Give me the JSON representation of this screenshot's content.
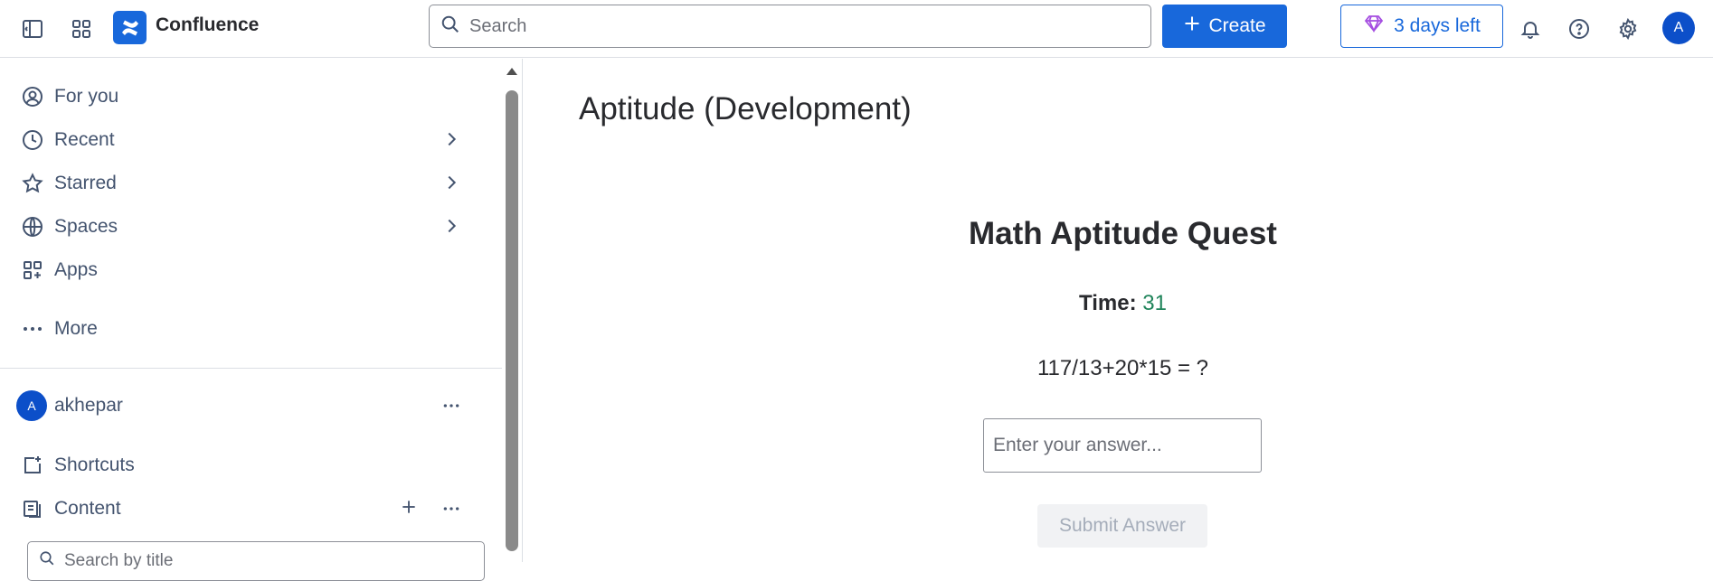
{
  "topbar": {
    "brand": "Confluence",
    "search_placeholder": "Search",
    "create_label": "Create",
    "trial_label": "3 days left",
    "avatar_initial": "A",
    "icons": [
      "sidebar-toggle-icon",
      "app-switcher-icon",
      "confluence-logo-icon",
      "search-icon",
      "plus-icon",
      "diamond-icon",
      "bell-icon",
      "help-icon",
      "gear-icon"
    ]
  },
  "sidebar": {
    "items": [
      {
        "label": "For you",
        "icon": "user-circle-icon"
      },
      {
        "label": "Recent",
        "icon": "clock-icon"
      },
      {
        "label": "Starred",
        "icon": "star-icon"
      },
      {
        "label": "Spaces",
        "icon": "globe-icon"
      },
      {
        "label": "Apps",
        "icon": "apps-icon"
      },
      {
        "label": "More",
        "icon": "more-dots-icon"
      }
    ],
    "space": {
      "avatar_initial": "A",
      "name": "akhepar"
    },
    "shortcuts_label": "Shortcuts",
    "content_label": "Content",
    "search_placeholder": "Search by title"
  },
  "main": {
    "page_title": "Aptitude (Development)",
    "quest_title": "Math Aptitude Quest",
    "timer_label": "Time:",
    "timer_value": "31",
    "question": "117/13+20*15 = ?",
    "answer_placeholder": "Enter your answer...",
    "submit_label": "Submit Answer"
  },
  "colors": {
    "accent": "#1868db",
    "timer": "#1f845a",
    "avatar": "#0c4fc9"
  }
}
